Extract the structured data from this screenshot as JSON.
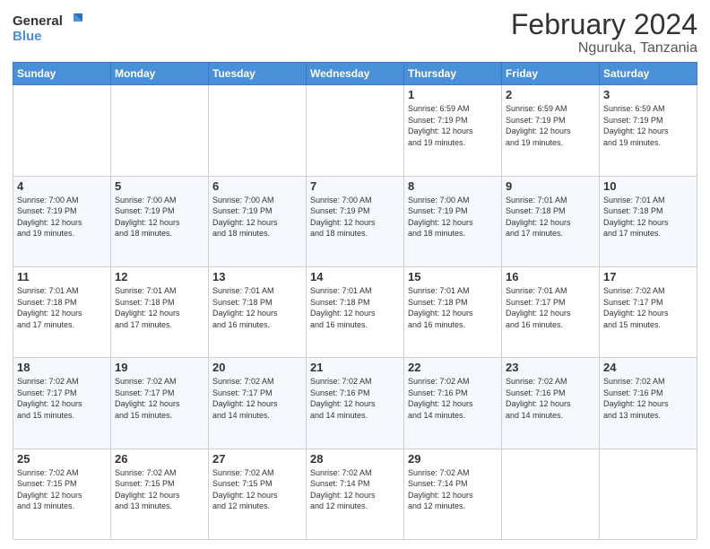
{
  "logo": {
    "general": "General",
    "blue": "Blue"
  },
  "header": {
    "month_year": "February 2024",
    "location": "Nguruka, Tanzania"
  },
  "days_of_week": [
    "Sunday",
    "Monday",
    "Tuesday",
    "Wednesday",
    "Thursday",
    "Friday",
    "Saturday"
  ],
  "weeks": [
    [
      {
        "day": "",
        "info": ""
      },
      {
        "day": "",
        "info": ""
      },
      {
        "day": "",
        "info": ""
      },
      {
        "day": "",
        "info": ""
      },
      {
        "day": "1",
        "info": "Sunrise: 6:59 AM\nSunset: 7:19 PM\nDaylight: 12 hours\nand 19 minutes."
      },
      {
        "day": "2",
        "info": "Sunrise: 6:59 AM\nSunset: 7:19 PM\nDaylight: 12 hours\nand 19 minutes."
      },
      {
        "day": "3",
        "info": "Sunrise: 6:59 AM\nSunset: 7:19 PM\nDaylight: 12 hours\nand 19 minutes."
      }
    ],
    [
      {
        "day": "4",
        "info": "Sunrise: 7:00 AM\nSunset: 7:19 PM\nDaylight: 12 hours\nand 19 minutes."
      },
      {
        "day": "5",
        "info": "Sunrise: 7:00 AM\nSunset: 7:19 PM\nDaylight: 12 hours\nand 18 minutes."
      },
      {
        "day": "6",
        "info": "Sunrise: 7:00 AM\nSunset: 7:19 PM\nDaylight: 12 hours\nand 18 minutes."
      },
      {
        "day": "7",
        "info": "Sunrise: 7:00 AM\nSunset: 7:19 PM\nDaylight: 12 hours\nand 18 minutes."
      },
      {
        "day": "8",
        "info": "Sunrise: 7:00 AM\nSunset: 7:19 PM\nDaylight: 12 hours\nand 18 minutes."
      },
      {
        "day": "9",
        "info": "Sunrise: 7:01 AM\nSunset: 7:18 PM\nDaylight: 12 hours\nand 17 minutes."
      },
      {
        "day": "10",
        "info": "Sunrise: 7:01 AM\nSunset: 7:18 PM\nDaylight: 12 hours\nand 17 minutes."
      }
    ],
    [
      {
        "day": "11",
        "info": "Sunrise: 7:01 AM\nSunset: 7:18 PM\nDaylight: 12 hours\nand 17 minutes."
      },
      {
        "day": "12",
        "info": "Sunrise: 7:01 AM\nSunset: 7:18 PM\nDaylight: 12 hours\nand 17 minutes."
      },
      {
        "day": "13",
        "info": "Sunrise: 7:01 AM\nSunset: 7:18 PM\nDaylight: 12 hours\nand 16 minutes."
      },
      {
        "day": "14",
        "info": "Sunrise: 7:01 AM\nSunset: 7:18 PM\nDaylight: 12 hours\nand 16 minutes."
      },
      {
        "day": "15",
        "info": "Sunrise: 7:01 AM\nSunset: 7:18 PM\nDaylight: 12 hours\nand 16 minutes."
      },
      {
        "day": "16",
        "info": "Sunrise: 7:01 AM\nSunset: 7:17 PM\nDaylight: 12 hours\nand 16 minutes."
      },
      {
        "day": "17",
        "info": "Sunrise: 7:02 AM\nSunset: 7:17 PM\nDaylight: 12 hours\nand 15 minutes."
      }
    ],
    [
      {
        "day": "18",
        "info": "Sunrise: 7:02 AM\nSunset: 7:17 PM\nDaylight: 12 hours\nand 15 minutes."
      },
      {
        "day": "19",
        "info": "Sunrise: 7:02 AM\nSunset: 7:17 PM\nDaylight: 12 hours\nand 15 minutes."
      },
      {
        "day": "20",
        "info": "Sunrise: 7:02 AM\nSunset: 7:17 PM\nDaylight: 12 hours\nand 14 minutes."
      },
      {
        "day": "21",
        "info": "Sunrise: 7:02 AM\nSunset: 7:16 PM\nDaylight: 12 hours\nand 14 minutes."
      },
      {
        "day": "22",
        "info": "Sunrise: 7:02 AM\nSunset: 7:16 PM\nDaylight: 12 hours\nand 14 minutes."
      },
      {
        "day": "23",
        "info": "Sunrise: 7:02 AM\nSunset: 7:16 PM\nDaylight: 12 hours\nand 14 minutes."
      },
      {
        "day": "24",
        "info": "Sunrise: 7:02 AM\nSunset: 7:16 PM\nDaylight: 12 hours\nand 13 minutes."
      }
    ],
    [
      {
        "day": "25",
        "info": "Sunrise: 7:02 AM\nSunset: 7:15 PM\nDaylight: 12 hours\nand 13 minutes."
      },
      {
        "day": "26",
        "info": "Sunrise: 7:02 AM\nSunset: 7:15 PM\nDaylight: 12 hours\nand 13 minutes."
      },
      {
        "day": "27",
        "info": "Sunrise: 7:02 AM\nSunset: 7:15 PM\nDaylight: 12 hours\nand 12 minutes."
      },
      {
        "day": "28",
        "info": "Sunrise: 7:02 AM\nSunset: 7:14 PM\nDaylight: 12 hours\nand 12 minutes."
      },
      {
        "day": "29",
        "info": "Sunrise: 7:02 AM\nSunset: 7:14 PM\nDaylight: 12 hours\nand 12 minutes."
      },
      {
        "day": "",
        "info": ""
      },
      {
        "day": "",
        "info": ""
      }
    ]
  ]
}
